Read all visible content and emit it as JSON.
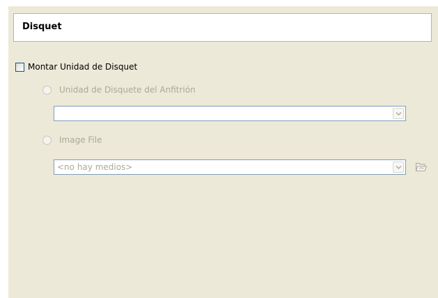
{
  "header": {
    "title": "Disquet"
  },
  "mount": {
    "label": "Montar Unidad de Disquet",
    "checked": false
  },
  "host_drive": {
    "label": "Unidad de Disquete del Anfitrión",
    "selected_value": ""
  },
  "image_file": {
    "label": "Image File",
    "selected_value": "<no hay medios>"
  },
  "icons": {
    "combo_arrow": "chevron-down-icon",
    "open_media": "folder-open-icon"
  },
  "colors": {
    "pane_background": "#ece9d8",
    "disabled_text": "#aca899",
    "combo_border": "#7f9db9"
  }
}
